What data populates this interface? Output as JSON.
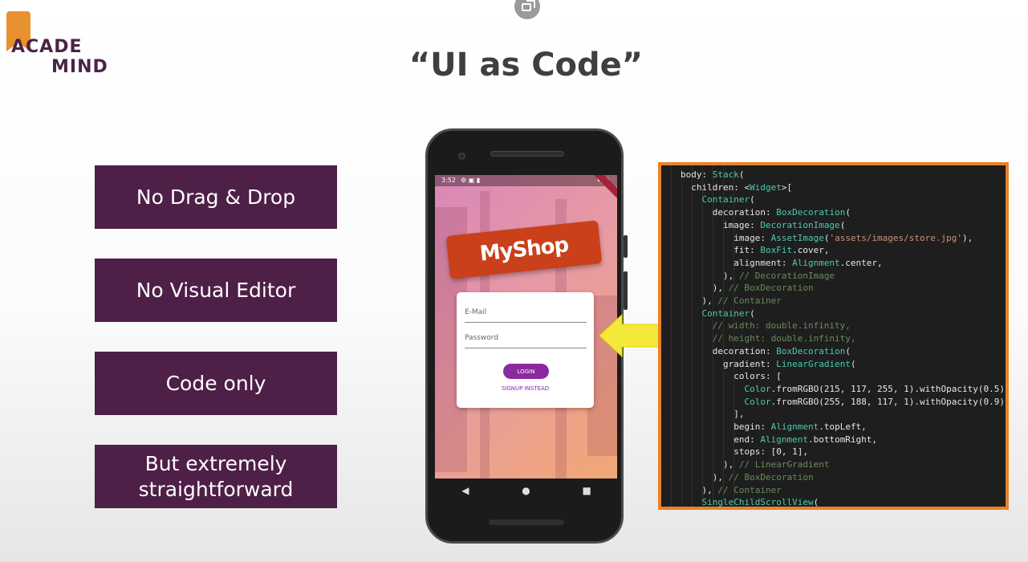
{
  "slide": {
    "title": "“UI as Code”",
    "logo": {
      "line1": "ACADE",
      "line2": "MIND"
    }
  },
  "features": [
    {
      "label": "No Drag & Drop"
    },
    {
      "label": "No Visual Editor"
    },
    {
      "label": "Code only"
    },
    {
      "label": "But extremely straightforward"
    }
  ],
  "phone": {
    "status_time": "3:52",
    "status_icons": "⚙ ▣ ▮",
    "status_right": "▾◢▮",
    "app_banner": "MyShop",
    "email_label": "E-Mail",
    "password_label": "Password",
    "login_label": "LOGIN",
    "signup_label": "SIGNUP INSTEAD",
    "nav": {
      "back": "◀",
      "home": "●",
      "recents": "■"
    },
    "accent_color": "#8a2a9e"
  },
  "code": {
    "lines": [
      "body: Stack(",
      "  children: <Widget>[",
      "    Container(",
      "      decoration: BoxDecoration(",
      "        image: DecorationImage(",
      "          image: AssetImage('assets/images/store.jpg'),",
      "          fit: BoxFit.cover,",
      "          alignment: Alignment.center,",
      "        ), // DecorationImage",
      "      ), // BoxDecoration",
      "    ), // Container",
      "    Container(",
      "      // width: double.infinity,",
      "      // height: double.infinity,",
      "      decoration: BoxDecoration(",
      "        gradient: LinearGradient(",
      "          colors: [",
      "            Color.fromRGBO(215, 117, 255, 1).withOpacity(0.5),",
      "            Color.fromRGBO(255, 188, 117, 1).withOpacity(0.9),",
      "          ],",
      "          begin: Alignment.topLeft,",
      "          end: Alignment.bottomRight,",
      "          stops: [0, 1],",
      "        ), // LinearGradient",
      "      ), // BoxDecoration",
      "    ), // Container",
      "    SingleChildScrollView("
    ],
    "border_color": "#e8822a"
  },
  "colors": {
    "box_bg": "#4e1f47",
    "arrow": "#f3e93a",
    "title": "#3f3f3f"
  },
  "icons": {
    "top_button": "open-in-new-icon",
    "arrow": "arrow-left-icon"
  }
}
